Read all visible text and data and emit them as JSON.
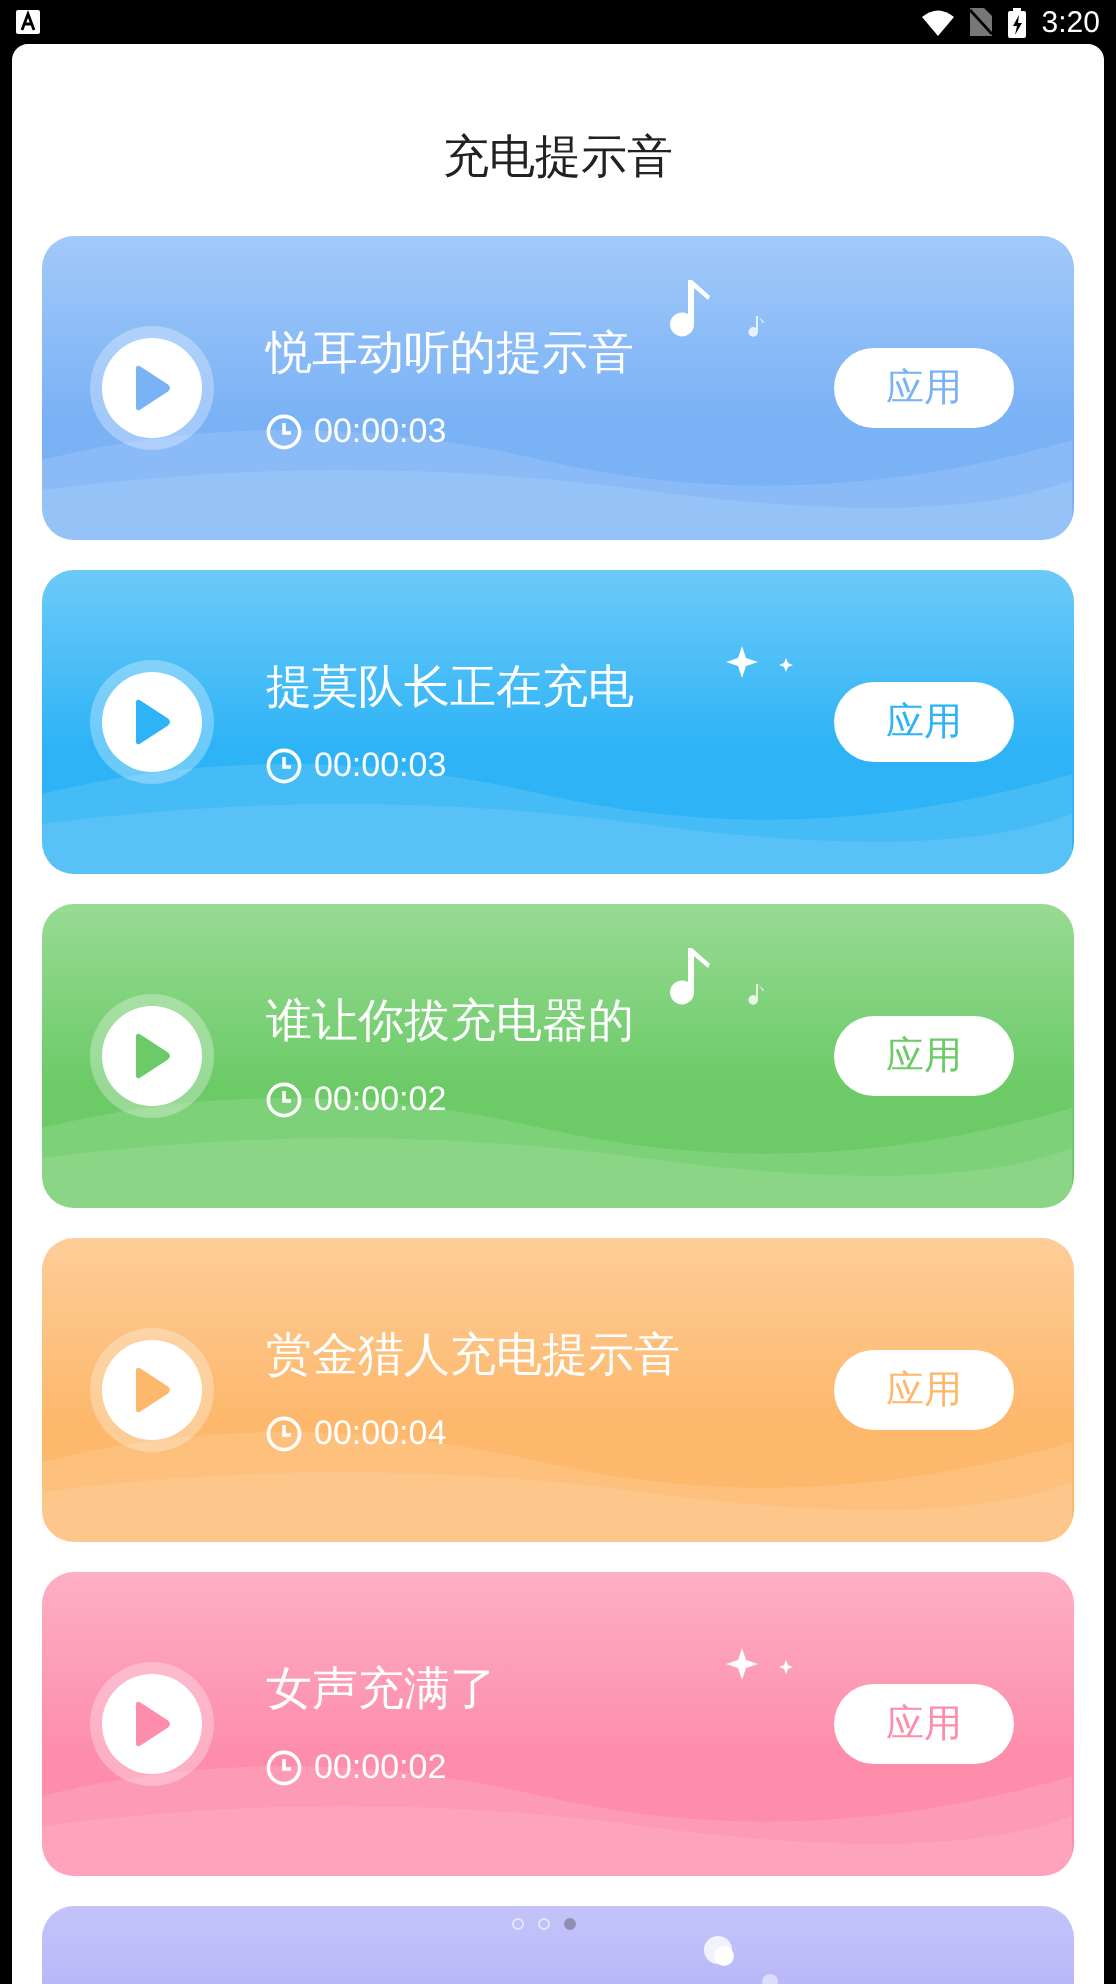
{
  "status_bar": {
    "time": "3:20"
  },
  "title": "充电提示音",
  "cards": [
    {
      "title": "悦耳动听的提示音",
      "duration": "00:00:03",
      "button": "应用",
      "color": "#7ab2f6",
      "kind": "note"
    },
    {
      "title": "提莫队长正在充电",
      "duration": "00:00:03",
      "button": "应用",
      "color": "#2db3f6",
      "kind": "sparkle"
    },
    {
      "title": "谁让你拔充电器的",
      "duration": "00:00:02",
      "button": "应用",
      "color": "#6ccb67",
      "kind": "note"
    },
    {
      "title": "赏金猎人充电提示音",
      "duration": "00:00:04",
      "button": "应用",
      "color": "#fdb86c",
      "kind": "plain"
    },
    {
      "title": "女声充满了",
      "duration": "00:00:02",
      "button": "应用",
      "color": "#fd8dab",
      "kind": "sparkle"
    },
    {
      "color": "#aaaaf8",
      "kind": "bubble"
    }
  ],
  "page_dots": [
    {
      "selected": false
    },
    {
      "selected": false
    },
    {
      "selected": true
    }
  ]
}
